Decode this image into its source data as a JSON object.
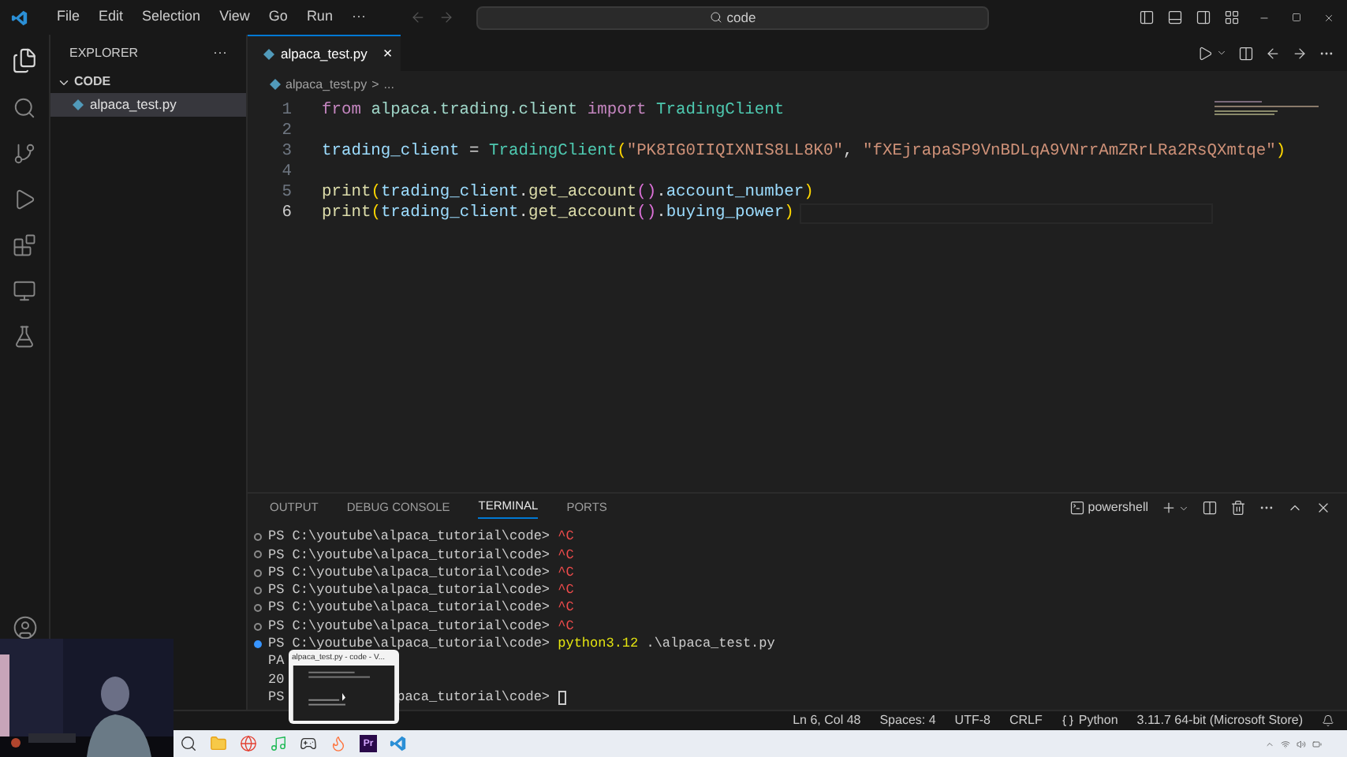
{
  "menu": [
    "File",
    "Edit",
    "Selection",
    "View",
    "Go",
    "Run",
    "···"
  ],
  "search": {
    "value": "code"
  },
  "sidebar": {
    "title": "EXPLORER",
    "more": "···",
    "folder": "CODE",
    "files": [
      {
        "name": "alpaca_test.py",
        "selected": true
      }
    ]
  },
  "tabs": [
    {
      "label": "alpaca_test.py",
      "selected": true,
      "close": "×"
    }
  ],
  "breadcrumb": [
    "alpaca_test.py",
    ">",
    "..."
  ],
  "code": [
    {
      "number": "1",
      "active": false,
      "tokens": [
        {
          "kind": "keyword",
          "text": "from"
        },
        {
          "kind": "module",
          "text": " alpaca.trading.client"
        },
        {
          "kind": "keyword",
          "text": " import"
        },
        {
          "kind": "class",
          "text": " TradingClient"
        }
      ]
    },
    {
      "number": "2",
      "active": false
    },
    {
      "number": "3",
      "active": false,
      "tokens": [
        {
          "kind": "var",
          "text": "trading_client"
        },
        {
          "kind": "plain",
          "text": " = "
        },
        {
          "kind": "class",
          "text": "TradingClient"
        },
        {
          "kind": "paren",
          "text": "("
        },
        {
          "kind": "string",
          "text": "\"PK8IG0IIQIXNIS8LL8K0\""
        },
        {
          "kind": "plain",
          "text": ", "
        },
        {
          "kind": "string",
          "text": "\"fXEjrapaSP9VnBDLqA9VNrrAmZRrLRa2RsQXmtqe\""
        },
        {
          "kind": "paren",
          "text": ")"
        }
      ]
    },
    {
      "number": "4",
      "active": false
    },
    {
      "number": "5",
      "active": false,
      "tokens": [
        {
          "kind": "func",
          "text": "print"
        },
        {
          "kind": "paren",
          "text": "("
        },
        {
          "kind": "var",
          "text": "trading_client"
        },
        {
          "kind": "plain",
          "text": "."
        },
        {
          "kind": "func",
          "text": "get_account"
        },
        {
          "kind": "paren2",
          "text": "()"
        },
        {
          "kind": "plain",
          "text": "."
        },
        {
          "kind": "var",
          "text": "account_number"
        },
        {
          "kind": "paren",
          "text": ")"
        }
      ]
    },
    {
      "number": "6",
      "active": true,
      "tokens": [
        {
          "kind": "func",
          "text": "print"
        },
        {
          "kind": "paren",
          "text": "("
        },
        {
          "kind": "var",
          "text": "trading_client"
        },
        {
          "kind": "plain",
          "text": "."
        },
        {
          "kind": "func",
          "text": "get_account"
        },
        {
          "kind": "paren2",
          "text": "()"
        },
        {
          "kind": "plain",
          "text": "."
        },
        {
          "kind": "var",
          "text": "buying_power"
        },
        {
          "kind": "paren",
          "text": ")"
        }
      ]
    }
  ],
  "panel_tabs": [
    {
      "label": "OUTPUT",
      "selected": false
    },
    {
      "label": "DEBUG CONSOLE",
      "selected": false
    },
    {
      "label": "TERMINAL",
      "selected": true
    },
    {
      "label": "PORTS",
      "selected": false
    }
  ],
  "terminal_name": "powershell",
  "terminal": [
    {
      "kind": "done",
      "parts": [
        {
          "kind": "prompt",
          "text": "PS C:\\youtube\\alpaca_tutorial\\code>"
        },
        {
          "kind": "interrupt",
          "text": "^C"
        }
      ]
    },
    {
      "kind": "done",
      "parts": [
        {
          "kind": "prompt",
          "text": "PS C:\\youtube\\alpaca_tutorial\\code>"
        },
        {
          "kind": "interrupt",
          "text": "^C"
        }
      ]
    },
    {
      "kind": "done",
      "parts": [
        {
          "kind": "prompt",
          "text": "PS C:\\youtube\\alpaca_tutorial\\code>"
        },
        {
          "kind": "interrupt",
          "text": "^C"
        }
      ]
    },
    {
      "kind": "done",
      "parts": [
        {
          "kind": "prompt",
          "text": "PS C:\\youtube\\alpaca_tutorial\\code>"
        },
        {
          "kind": "interrupt",
          "text": "^C"
        }
      ]
    },
    {
      "kind": "done",
      "parts": [
        {
          "kind": "prompt",
          "text": "PS C:\\youtube\\alpaca_tutorial\\code>"
        },
        {
          "kind": "interrupt",
          "text": "^C"
        }
      ]
    },
    {
      "kind": "done",
      "parts": [
        {
          "kind": "prompt",
          "text": "PS C:\\youtube\\alpaca_tutorial\\code>"
        },
        {
          "kind": "interrupt",
          "text": "^C"
        }
      ]
    },
    {
      "kind": "running",
      "parts": [
        {
          "kind": "prompt",
          "text": "PS C:\\youtube\\alpaca_tutorial\\code>"
        },
        {
          "kind": "command",
          "text": "python3.12"
        },
        {
          "kind": "plain",
          "text": ".\\alpaca_test.py"
        }
      ]
    },
    {
      "kind": "output",
      "parts": [
        {
          "kind": "plain",
          "text": "PA"
        }
      ]
    },
    {
      "kind": "output",
      "parts": [
        {
          "kind": "plain",
          "text": "20"
        }
      ]
    },
    {
      "kind": "output",
      "parts": [
        {
          "kind": "plain",
          "text": "PS"
        },
        {
          "kind": "hidden"
        },
        {
          "kind": "prompt",
          "text": "paca_tutorial\\code>"
        },
        {
          "kind": "cursor"
        }
      ]
    }
  ],
  "status_bar": [
    "Ln 6, Col 48",
    "Spaces: 4",
    "UTF-8",
    "CRLF",
    "Python",
    "3.11.7 64-bit (Microsoft Store)"
  ],
  "preview": {
    "title": "alpaca_test.py - code - V..."
  },
  "taskbar": [
    {
      "kind": "search"
    },
    {
      "kind": "folder"
    },
    {
      "kind": "browser"
    },
    {
      "kind": "music"
    },
    {
      "kind": "game"
    },
    {
      "kind": "fox"
    },
    {
      "kind": "pr",
      "text": "Pr"
    },
    {
      "kind": "vscode"
    }
  ],
  "webcam": {
    "kind": "picture"
  }
}
